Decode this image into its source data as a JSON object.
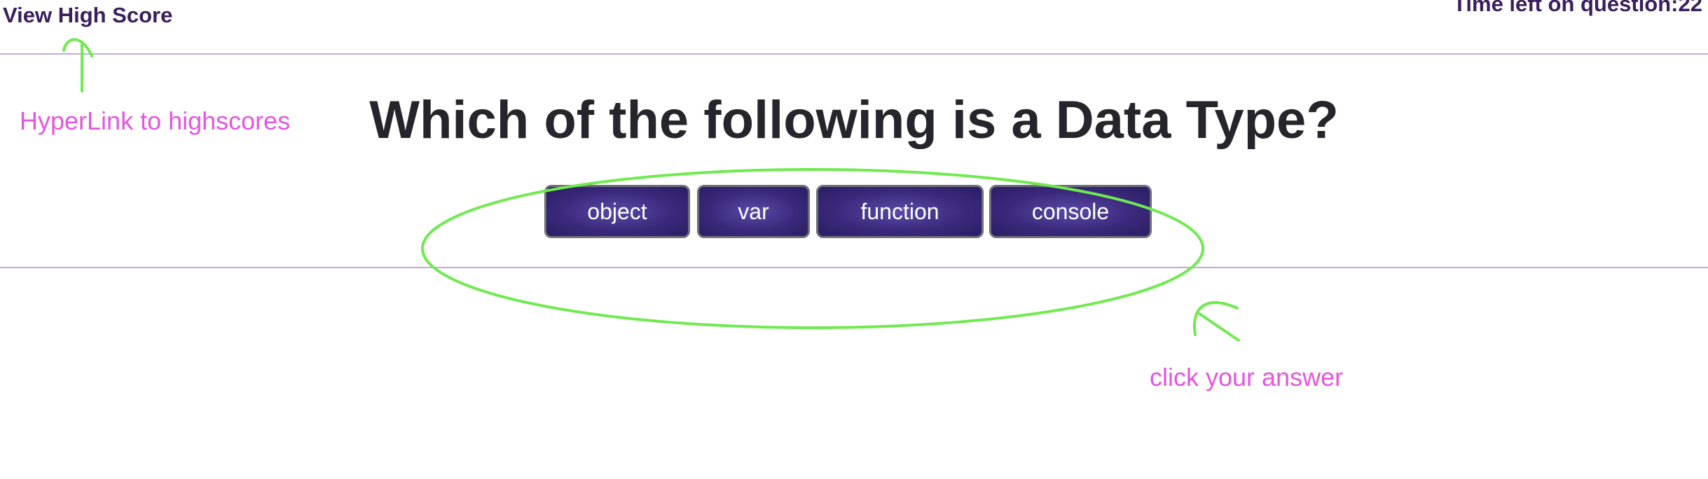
{
  "header": {
    "highscore_link_label": "View High Score",
    "timer_label": "Time left on question:22"
  },
  "quiz": {
    "question": "Which of the following is a Data Type?",
    "choices": [
      "object",
      "var",
      "function",
      "console"
    ]
  },
  "annotations": {
    "highscore_note": "HyperLink to highscores",
    "answer_note": "click your answer"
  },
  "colors": {
    "header_text": "#3a1f5d",
    "button_fill": "#3b2a7c",
    "annotation_text": "#e455e0",
    "annotation_stroke": "#6fea4f",
    "divider": "#c6a8d6"
  }
}
